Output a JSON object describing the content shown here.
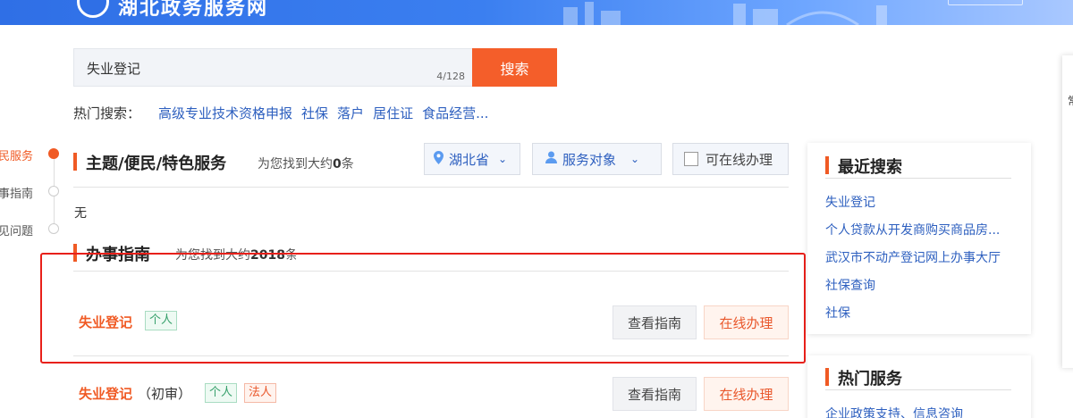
{
  "header": {
    "site_title": "湖北政务服务网"
  },
  "search": {
    "value": "失业登记",
    "count": "4/128",
    "button": "搜索"
  },
  "hot": {
    "label": "热门搜索：",
    "links": [
      "高级专业技术资格申报",
      "社保",
      "落户",
      "居住证",
      "食品经营..."
    ]
  },
  "rail": {
    "items": [
      "民服务",
      "事指南",
      "见问题"
    ]
  },
  "section_theme": {
    "title": "主题/便民/特色服务",
    "count_prefix": "为您找到大约",
    "count": "0",
    "count_suffix": "条",
    "filters": {
      "region": "湖北省",
      "audience": "服务对象",
      "online": "可在线办理"
    },
    "empty_text": "无"
  },
  "section_guide": {
    "title": "办事指南",
    "count_prefix": "为您找到大约",
    "count": "2018",
    "count_suffix": "条",
    "results": [
      {
        "title": "失业登记",
        "subtitle": "",
        "tags": [
          "个人"
        ],
        "guide_btn": "查看指南",
        "online_btn": "在线办理"
      },
      {
        "title": "失业登记",
        "subtitle": "（初审）",
        "tags": [
          "个人",
          "法人"
        ],
        "guide_btn": "查看指南",
        "online_btn": "在线办理"
      }
    ]
  },
  "recent": {
    "title": "最近搜索",
    "items": [
      "失业登记",
      "个人贷款从开发商购买商品房...",
      "武汉市不动产登记网上办事大厅",
      "社保查询",
      "社保"
    ]
  },
  "hot_services": {
    "title": "热门服务",
    "items": [
      "企业政策支持、信息咨询"
    ]
  },
  "edge": {
    "char": "常"
  },
  "colors": {
    "accent": "#f05a24",
    "link": "#2d5fbf",
    "banner": "#3b7ff0",
    "highlight": "#e8201a"
  }
}
